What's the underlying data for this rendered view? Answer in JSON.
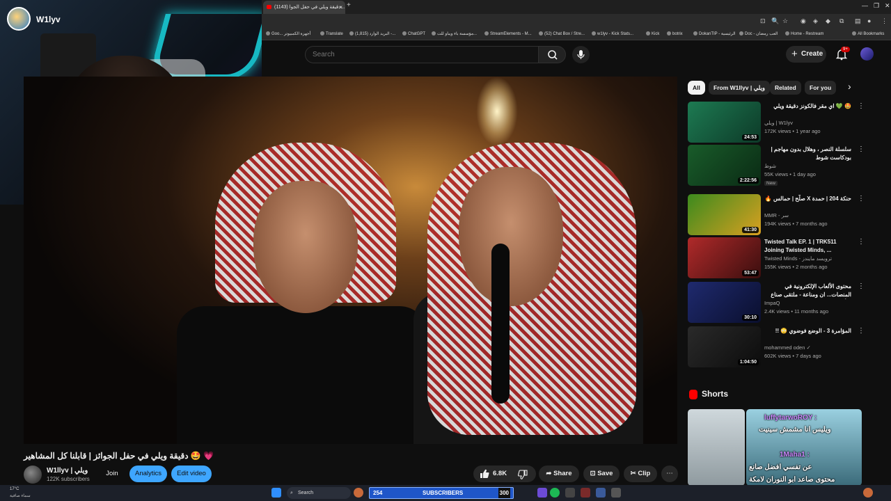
{
  "webcam": {
    "streamer_name": "W1lyv"
  },
  "browser": {
    "tab_title": "(1143) دقيقة ويلي في حفل الجوا...",
    "tab_close": "×",
    "new_tab": "+",
    "bookmarks": [
      {
        "label": "Goo... أجهزة الكمبيوتر"
      },
      {
        "label": "Translate"
      },
      {
        "label": "(1,815) البريد الوارد -..."
      },
      {
        "label": "ChatGPT"
      },
      {
        "label": "مؤسسة باء ويباو للت..."
      },
      {
        "label": "StreamElements - M..."
      },
      {
        "label": "(52) Chat Box / Stre..."
      },
      {
        "label": "w1lyv - Kick Stats..."
      },
      {
        "label": "Kick"
      },
      {
        "label": "botrix"
      },
      {
        "label": "DokanTIP - الرئيسية"
      },
      {
        "label": "Doc - العب رمضان"
      },
      {
        "label": "Home - Restream"
      },
      {
        "label": "All Bookmarks"
      }
    ]
  },
  "youtube": {
    "search_placeholder": "Search",
    "create_label": "Create",
    "create_plus": "+",
    "notification_badge": "9+"
  },
  "video": {
    "title": "💗 🤩 دقيقة ويلي في حفل الجوائز | قابلنا كل المشاهير",
    "channel_name": "W1llyv | ويلي",
    "subscribers": "122K subscribers",
    "join_label": "Join",
    "analytics_label": "Analytics",
    "edit_label": "Edit video",
    "like_count": "6.8K",
    "share_label": "Share",
    "save_label": "Save",
    "clip_label": "Clip",
    "more_label": "⋯"
  },
  "chips": [
    {
      "label": "All",
      "active": true
    },
    {
      "label": "From W1llyv | ويلي",
      "active": false
    },
    {
      "label": "Related",
      "active": false
    },
    {
      "label": "For you",
      "active": false
    }
  ],
  "chip_next": "›",
  "recommendations": [
    {
      "title": "🤩 💚 اي مقر فالكونز دقيقة ويلي",
      "channel": "ويلي | W1lyv",
      "meta": "172K views • 1 year ago",
      "duration": "24:53",
      "badge": "",
      "colors": [
        "#1d7a52",
        "#0d3a28"
      ]
    },
    {
      "title": "سلسلة النصر ، وهلال بدون مهاجم | بودكاست شوط",
      "channel": "شوط",
      "meta": "55K views • 1 day ago",
      "duration": "2:22:56",
      "badge": "New",
      "colors": [
        "#195c2a",
        "#0a2a14"
      ]
    },
    {
      "title": "حنكة 204 | حمدة X صلّح | حمالس 🔥",
      "channel": "MMR - سر",
      "meta": "194K views • 7 months ago",
      "duration": "41:30",
      "badge": "",
      "colors": [
        "#3c8a1e",
        "#d9a020"
      ]
    },
    {
      "title": "Twisted Talk EP. 1 | TRK511 Joining Twisted Minds, ...",
      "channel": "Twisted Minds - ترويسد مايندز",
      "meta": "155K views • 2 months ago",
      "duration": "53:47",
      "badge": "",
      "colors": [
        "#b02a2a",
        "#3a0e0e"
      ]
    },
    {
      "title": "محتوى الألعاب الإلكترونية في المنصات... ان ومناعة - ملتقى صناع التأثير ImpaQ",
      "channel": "ImpaQ",
      "meta": "2.4K views • 11 months ago",
      "duration": "30:10",
      "badge": "",
      "colors": [
        "#1f2a6e",
        "#0a0f2e"
      ]
    },
    {
      "title": "المؤامرة 3 - الوضع فوضوي 😳 !!",
      "channel": "mohammed oden ✓",
      "meta": "602K views • 7 days ago",
      "duration": "1:04:50",
      "badge": "",
      "colors": [
        "#2a2a2a",
        "#0c0c0c"
      ]
    }
  ],
  "rec_menu": "⋮",
  "shorts_title": "Shorts",
  "chat": [
    {
      "text": "luffytarwoROY :"
    },
    {
      "text": "ويليس انا مشمش سينيت"
    },
    {
      "text": "1Maha1 :"
    },
    {
      "text": "عن تفسي افضل صانع"
    },
    {
      "text": "محتوى صاعد ابو النوران لامكة"
    }
  ],
  "taskbar": {
    "weather_temp": "17°C",
    "weather_desc": "سماء صافية",
    "search_label": "Search",
    "sub_count": "254",
    "sub_label": "SUBSCRIBERS",
    "sub_goal": "300"
  }
}
